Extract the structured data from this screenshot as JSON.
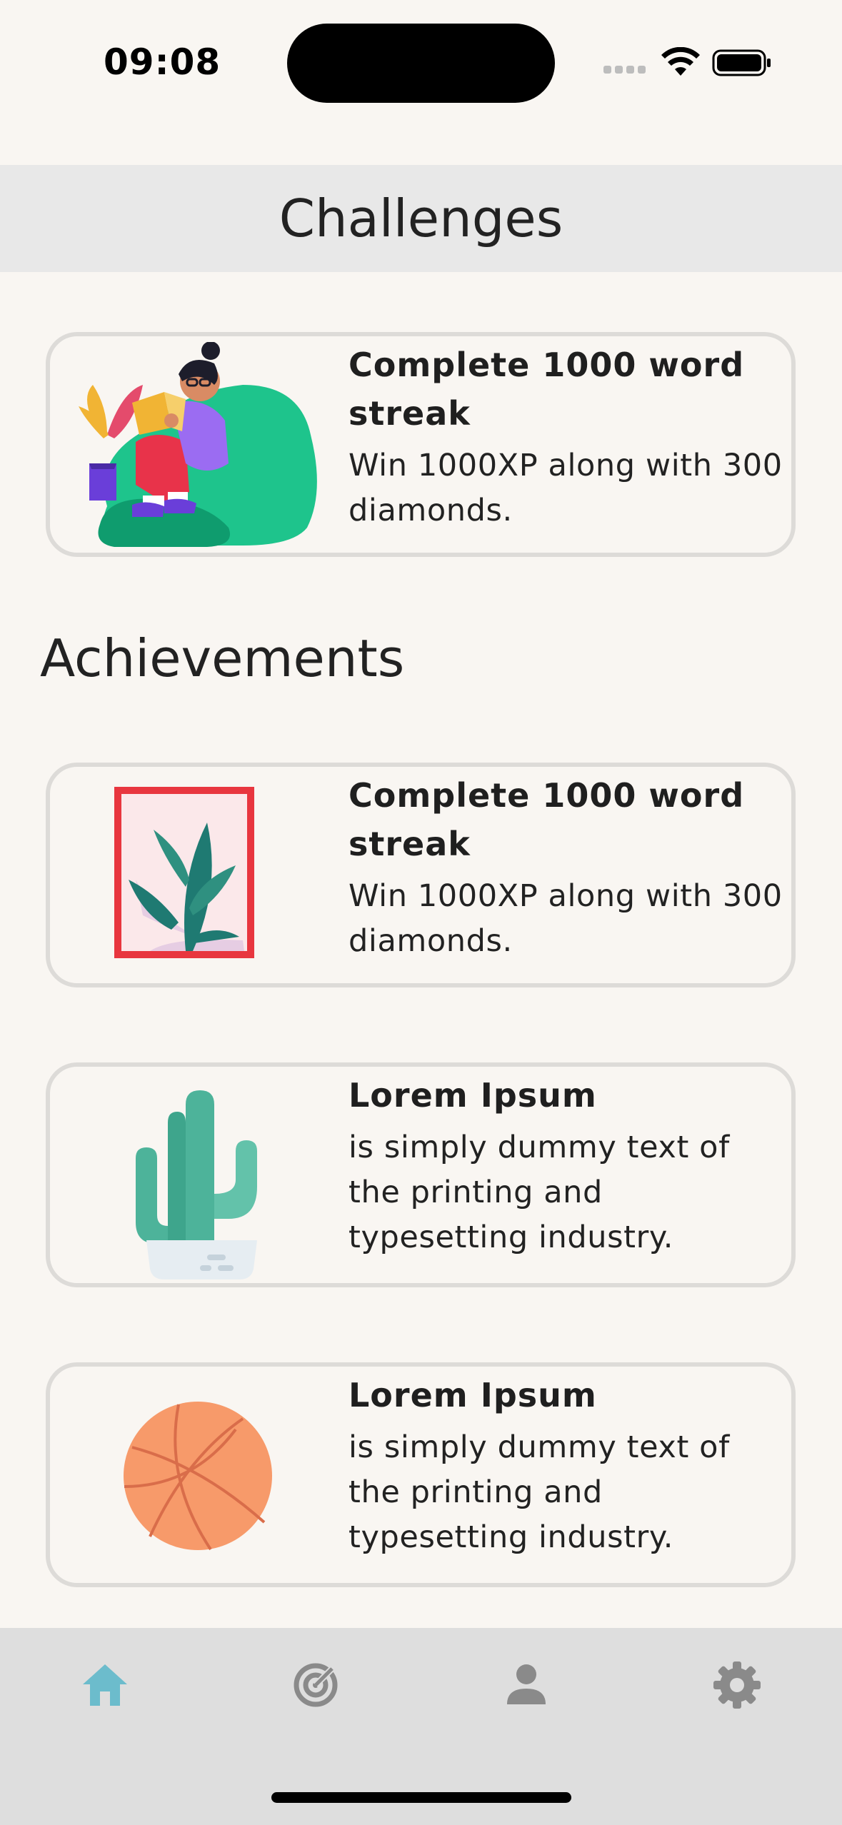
{
  "status_bar": {
    "time": "09:08",
    "icons": [
      "signal-icon",
      "wifi-icon",
      "battery-icon"
    ]
  },
  "header": {
    "title": "Challenges"
  },
  "challenges": [
    {
      "title": "Complete 1000 word streak",
      "description": "Win 1000XP along with 300 diamonds.",
      "illustration": "reading-girl-illustration"
    }
  ],
  "achievements_section": {
    "title": "Achievements"
  },
  "achievements": [
    {
      "title": "Complete 1000 word streak",
      "description": "Win 1000XP along with 300 diamonds.",
      "illustration": "framed-leaves-illustration"
    },
    {
      "title": "Lorem Ipsum",
      "description": "is simply dummy text of the printing and typesetting industry.",
      "illustration": "cactus-illustration"
    },
    {
      "title": "Lorem Ipsum",
      "description": "is simply dummy text of the printing and typesetting industry.",
      "illustration": "basketball-illustration"
    }
  ],
  "bottom_nav": {
    "items": [
      {
        "icon": "home-icon",
        "active": true
      },
      {
        "icon": "radar-icon",
        "active": false
      },
      {
        "icon": "person-icon",
        "active": false
      },
      {
        "icon": "gear-icon",
        "active": false
      }
    ],
    "active_color": "#6cbccc",
    "inactive_color": "#8a8a8a"
  },
  "colors": {
    "background": "#f9f6f2",
    "header_background": "#e8e8e8",
    "card_border": "#dddbd8"
  }
}
